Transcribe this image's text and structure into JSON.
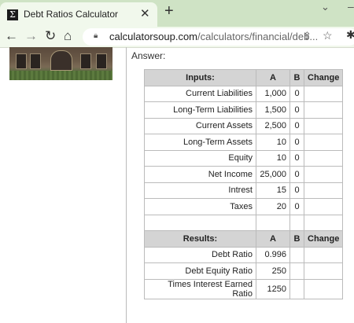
{
  "browser": {
    "tab_title": "Debt Ratios Calculator",
    "favicon": "Σ",
    "url_host": "calculatorsoup.com",
    "url_path": "/calculators/financial/deb..."
  },
  "page": {
    "answer_label": "Answer:"
  },
  "inputs_table": {
    "headers": [
      "Inputs:",
      "A",
      "B",
      "Change"
    ],
    "rows": [
      {
        "label": "Current Liabilities",
        "a": "1,000",
        "b": "0",
        "change": ""
      },
      {
        "label": "Long-Term Liabilities",
        "a": "1,500",
        "b": "0",
        "change": ""
      },
      {
        "label": "Current Assets",
        "a": "2,500",
        "b": "0",
        "change": ""
      },
      {
        "label": "Long-Term Assets",
        "a": "10",
        "b": "0",
        "change": ""
      },
      {
        "label": "Equity",
        "a": "10",
        "b": "0",
        "change": ""
      },
      {
        "label": "Net Income",
        "a": "25,000",
        "b": "0",
        "change": ""
      },
      {
        "label": "Intrest",
        "a": "15",
        "b": "0",
        "change": ""
      },
      {
        "label": "Taxes",
        "a": "20",
        "b": "0",
        "change": ""
      }
    ]
  },
  "results_table": {
    "headers": [
      "Results:",
      "A",
      "B",
      "Change"
    ],
    "rows": [
      {
        "label": "Debt Ratio",
        "a": "0.996",
        "b": "",
        "change": ""
      },
      {
        "label": "Debt Equity Ratio",
        "a": "250",
        "b": "",
        "change": ""
      },
      {
        "label": "Times Interest Earned Ratio",
        "a": "1250",
        "b": "",
        "change": ""
      }
    ]
  }
}
